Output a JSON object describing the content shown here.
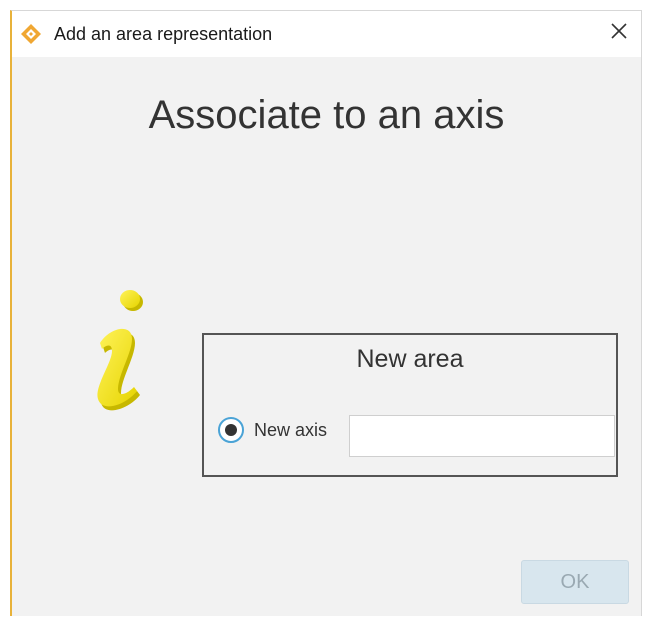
{
  "window": {
    "title": "Add an area representation",
    "close_icon": "close-icon",
    "app_icon": "diamond-app-icon",
    "accent_color": "#e8b23a"
  },
  "main": {
    "heading": "Associate to an axis",
    "info_icon": "info-icon"
  },
  "group": {
    "title": "New area",
    "radio_label": "New axis",
    "radio_selected": true,
    "axis_value": "",
    "axis_placeholder": ""
  },
  "footer": {
    "ok_label": "OK",
    "ok_enabled": false
  }
}
